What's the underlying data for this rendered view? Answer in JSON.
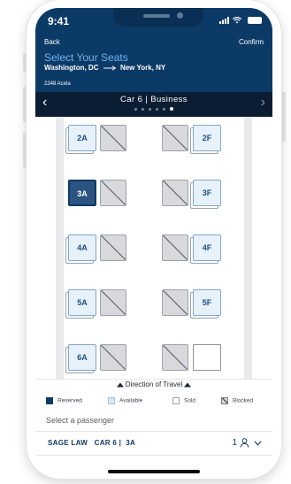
{
  "status": {
    "time": "9:41",
    "signal_icon": "signal-icon",
    "wifi_icon": "wifi-icon",
    "battery_icon": "battery-icon"
  },
  "header": {
    "back": "Back",
    "confirm": "Confirm",
    "title": "Select Your Seats",
    "origin": "Washington, DC",
    "destination": "New York, NY",
    "train": "2248 Acela"
  },
  "car_nav": {
    "label": "Car 6 | Business",
    "page_count": 6,
    "active_page": 6,
    "prev_icon": "chevron-left-icon",
    "next_icon": "chevron-right-icon"
  },
  "seats": [
    {
      "row": 2,
      "A": {
        "label": "2A",
        "status": "available"
      },
      "B": {
        "status": "blocked"
      },
      "E": {
        "status": "blocked"
      },
      "F": {
        "label": "2F",
        "status": "available"
      }
    },
    {
      "row": 3,
      "A": {
        "label": "3A",
        "status": "reserved"
      },
      "B": {
        "status": "blocked"
      },
      "E": {
        "status": "blocked"
      },
      "F": {
        "label": "3F",
        "status": "available"
      }
    },
    {
      "row": 4,
      "A": {
        "label": "4A",
        "status": "available"
      },
      "B": {
        "status": "blocked"
      },
      "E": {
        "status": "blocked"
      },
      "F": {
        "label": "4F",
        "status": "available"
      }
    },
    {
      "row": 5,
      "A": {
        "label": "5A",
        "status": "available"
      },
      "B": {
        "status": "blocked"
      },
      "E": {
        "status": "blocked"
      },
      "F": {
        "label": "5F",
        "status": "available"
      }
    },
    {
      "row": 6,
      "A": {
        "label": "6A",
        "status": "available"
      },
      "B": {
        "status": "blocked"
      },
      "E": {
        "status": "blocked"
      },
      "F": {
        "status": "sold"
      }
    }
  ],
  "direction": {
    "label": "Direction of Travel"
  },
  "legend": [
    {
      "label": "Reserved",
      "type": "reserved"
    },
    {
      "label": "Available",
      "type": "available"
    },
    {
      "label": "Sold",
      "type": "sold"
    },
    {
      "label": "Blocked",
      "type": "blocked"
    }
  ],
  "passenger": {
    "select_label": "Select a passenger",
    "selected": "SAGE LAW   CAR 6 |  3A",
    "count": "1",
    "person_icon": "person-icon",
    "dropdown_icon": "chevron-down-icon"
  },
  "colors": {
    "header_bg": "#0c3a66",
    "car_bar_bg": "#0b1d33",
    "title_accent": "#6fb3ef",
    "available_fill": "#e6f1fa",
    "reserved_fill": "#2b5580",
    "blocked_fill": "#d7d9dc"
  }
}
